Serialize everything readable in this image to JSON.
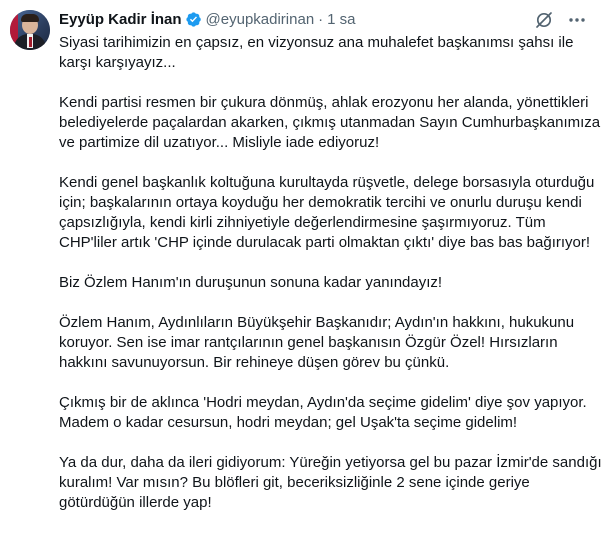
{
  "tweet": {
    "author_name": "Eyyüp Kadir İnan",
    "handle": "@eyupkadirinan",
    "separator": "·",
    "time": "1 sa",
    "paragraphs": [
      "Siyasi tarihimizin en çapsız, en vizyonsuz ana muhalefet başkanımsı şahsı ile karşı karşıyayız...",
      "Kendi partisi resmen bir çukura dönmüş, ahlak erozyonu her alanda, yönettikleri belediyelerde paçalardan akarken, çıkmış utanmadan Sayın Cumhurbaşkanımıza ve partimize dil uzatıyor... Misliyle iade ediyoruz!",
      "Kendi genel başkanlık koltuğuna kurultayda rüşvetle, delege borsasıyla oturduğu için; başkalarının ortaya koyduğu her demokratik tercihi ve onurlu duruşu kendi çapsızlığıyla, kendi kirli zihniyetiyle değerlendirmesine şaşırmıyoruz. Tüm CHP'liler artık 'CHP içinde durulacak parti olmaktan çıktı' diye bas bas bağırıyor!",
      "Biz Özlem Hanım'ın duruşunun sonuna kadar yanındayız!",
      "Özlem Hanım, Aydınlıların Büyükşehir Başkanıdır; Aydın'ın hakkını, hukukunu koruyor. Sen ise imar rantçılarının genel başkanısın Özgür Özel! Hırsızların hakkını savunuyorsun. Bir rehineye düşen görev bu çünkü.",
      "Çıkmış bir de aklınca 'Hodri meydan, Aydın'da seçime gidelim' diye şov yapıyor. Madem o kadar cesursun, hodri meydan; gel Uşak'ta seçime gidelim!",
      "Ya da dur, daha da ileri gidiyorum: Yüreğin yetiyorsa gel bu pazar İzmir'de sandığı kuralım! Var mısın? Bu blöfleri git, beceriksizliğinle 2 sene içinde geriye götürdüğün illerde yap!"
    ]
  },
  "icons": {
    "verified": "verified-badge-icon",
    "grok": "grok-icon",
    "more": "more-options-icon"
  },
  "colors": {
    "text": "#0f1419",
    "secondary": "#536471",
    "verified": "#1d9bf0"
  }
}
